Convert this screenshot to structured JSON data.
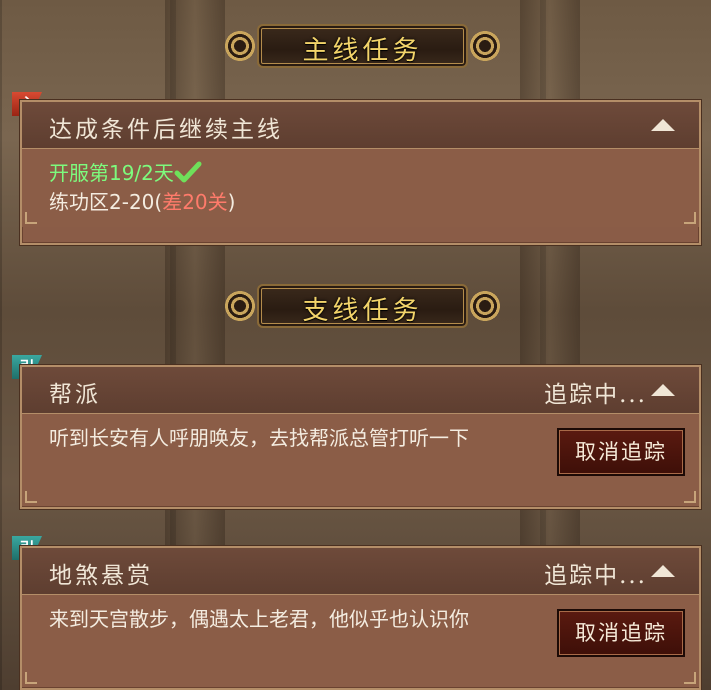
{
  "main_section": {
    "title": "主线任务",
    "task": {
      "tag": "主",
      "title": "达成条件后继续主线",
      "line1": "开服第19/2天",
      "line2_prefix": "练功区2-20(",
      "line2_red": "差20关",
      "line2_suffix": ")"
    }
  },
  "side_section": {
    "title": "支线任务",
    "tasks": [
      {
        "tag": "引",
        "title": "帮派",
        "status": "追踪中...",
        "description": "听到长安有人呼朋唤友，去找帮派总管打听一下",
        "button": "取消追踪"
      },
      {
        "tag": "引",
        "title": "地煞悬赏",
        "status": "追踪中...",
        "description": "来到天宫散步，偶遇太上老君，他似乎也认识你",
        "button": "取消追踪"
      }
    ]
  },
  "colors": {
    "accent_gold": "#f3d46a",
    "success_green": "#7dfb7d",
    "warning_red": "#ff7b6b",
    "main_tag": "#d84a32",
    "side_tag": "#3aa8a0"
  }
}
